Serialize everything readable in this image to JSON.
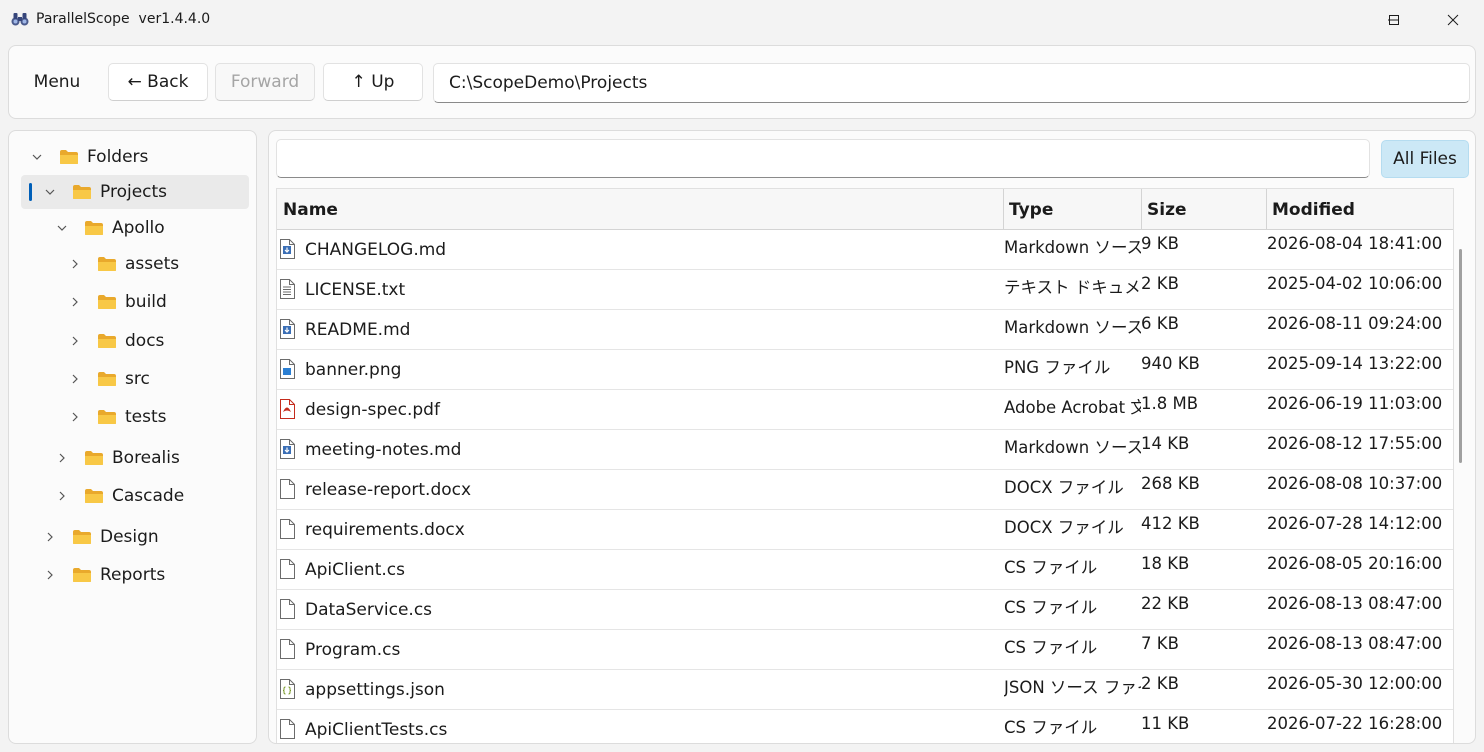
{
  "window": {
    "title": "ParallelScope  ver1.4.4.0",
    "controls": [
      "minimize",
      "maximize",
      "close"
    ]
  },
  "toolbar": {
    "menu_label": "Menu",
    "back_label": "← Back",
    "forward_label": "Forward",
    "up_label": "↑ Up",
    "path": "C:\\ScopeDemo\\Projects"
  },
  "sidebar": {
    "items": [
      {
        "label": "Folders",
        "expanded": true,
        "level": 0
      },
      {
        "label": "Projects",
        "expanded": true,
        "level": 1,
        "selected": true
      },
      {
        "label": "Apollo",
        "expanded": true,
        "level": 2
      },
      {
        "label": "assets",
        "expanded": false,
        "level": 3
      },
      {
        "label": "build",
        "expanded": false,
        "level": 3
      },
      {
        "label": "docs",
        "expanded": false,
        "level": 3
      },
      {
        "label": "src",
        "expanded": false,
        "level": 3
      },
      {
        "label": "tests",
        "expanded": false,
        "level": 3
      },
      {
        "label": "Borealis",
        "expanded": false,
        "level": 2
      },
      {
        "label": "Cascade",
        "expanded": false,
        "level": 2
      },
      {
        "label": "Design",
        "expanded": false,
        "level": 1
      },
      {
        "label": "Reports",
        "expanded": false,
        "level": 1
      }
    ]
  },
  "filter": {
    "value": "",
    "all_files_label": "All Files"
  },
  "table": {
    "headers": {
      "name": "Name",
      "type": "Type",
      "size": "Size",
      "modified": "Modified"
    },
    "rows": [
      {
        "name": "CHANGELOG.md",
        "type": "Markdown ソース ファイル",
        "size": "9 KB",
        "modified": "2026-08-04 18:41:00",
        "icon": "markdown-file-icon"
      },
      {
        "name": "LICENSE.txt",
        "type": "テキスト ドキュメント",
        "size": "2 KB",
        "modified": "2025-04-02 10:06:00",
        "icon": "text-file-icon"
      },
      {
        "name": "README.md",
        "type": "Markdown ソース ファイル",
        "size": "6 KB",
        "modified": "2026-08-11 09:24:00",
        "icon": "markdown-file-icon"
      },
      {
        "name": "banner.png",
        "type": "PNG ファイル",
        "size": "940 KB",
        "modified": "2025-09-14 13:22:00",
        "icon": "image-file-icon"
      },
      {
        "name": "design-spec.pdf",
        "type": "Adobe Acrobat 文書",
        "size": "1.8 MB",
        "modified": "2026-06-19 11:03:00",
        "icon": "pdf-file-icon"
      },
      {
        "name": "meeting-notes.md",
        "type": "Markdown ソース ファイル",
        "size": "14 KB",
        "modified": "2026-08-12 17:55:00",
        "icon": "markdown-file-icon"
      },
      {
        "name": "release-report.docx",
        "type": "DOCX ファイル",
        "size": "268 KB",
        "modified": "2026-08-08 10:37:00",
        "icon": "blank-file-icon"
      },
      {
        "name": "requirements.docx",
        "type": "DOCX ファイル",
        "size": "412 KB",
        "modified": "2026-07-28 14:12:00",
        "icon": "blank-file-icon"
      },
      {
        "name": "ApiClient.cs",
        "type": "CS ファイル",
        "size": "18 KB",
        "modified": "2026-08-05 20:16:00",
        "icon": "blank-file-icon"
      },
      {
        "name": "DataService.cs",
        "type": "CS ファイル",
        "size": "22 KB",
        "modified": "2026-08-13 08:47:00",
        "icon": "blank-file-icon"
      },
      {
        "name": "Program.cs",
        "type": "CS ファイル",
        "size": "7 KB",
        "modified": "2026-08-13 08:47:00",
        "icon": "blank-file-icon"
      },
      {
        "name": "appsettings.json",
        "type": "JSON ソース ファイル",
        "size": "2 KB",
        "modified": "2026-05-30 12:00:00",
        "icon": "json-file-icon"
      },
      {
        "name": "ApiClientTests.cs",
        "type": "CS ファイル",
        "size": "11 KB",
        "modified": "2026-07-22 16:28:00",
        "icon": "blank-file-icon"
      }
    ]
  },
  "colors": {
    "accent": "#005fb8",
    "all_files_bg": "#cce8f6",
    "folder": "#f8c846"
  }
}
